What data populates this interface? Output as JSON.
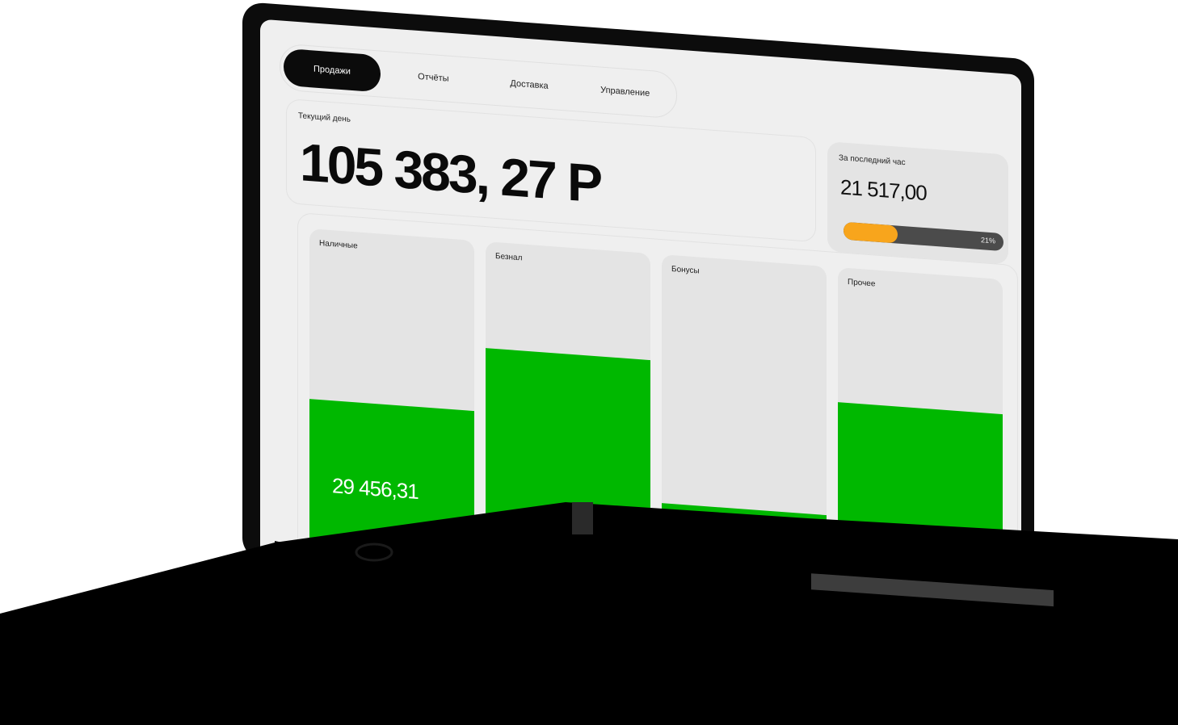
{
  "nav": {
    "tabs": [
      {
        "label": "Продажи",
        "active": true
      },
      {
        "label": "Отчёты",
        "active": false
      },
      {
        "label": "Доставка",
        "active": false
      },
      {
        "label": "Управление",
        "active": false
      }
    ]
  },
  "current_day": {
    "label": "Текущий день",
    "amount": "105 383, 27 Р"
  },
  "last_hour": {
    "label": "За последний час",
    "value": "21 517,00",
    "progress_percent": 21,
    "progress_text": "21%",
    "progress_color": "#f8a51c"
  },
  "payments": [
    {
      "label": "Наличные",
      "value": "29 456,31",
      "fill_fraction": 0.52
    },
    {
      "label": "Безнал",
      "value": "",
      "fill_fraction": 0.7
    },
    {
      "label": "Бонусы",
      "value": "",
      "fill_fraction": 0.3
    },
    {
      "label": "Прочее",
      "value": "",
      "fill_fraction": 0.62
    }
  ],
  "colors": {
    "accent_green": "#00b800",
    "progress_orange": "#f8a51c",
    "screen_bg": "#efefef",
    "frame": "#0c0c0c"
  }
}
